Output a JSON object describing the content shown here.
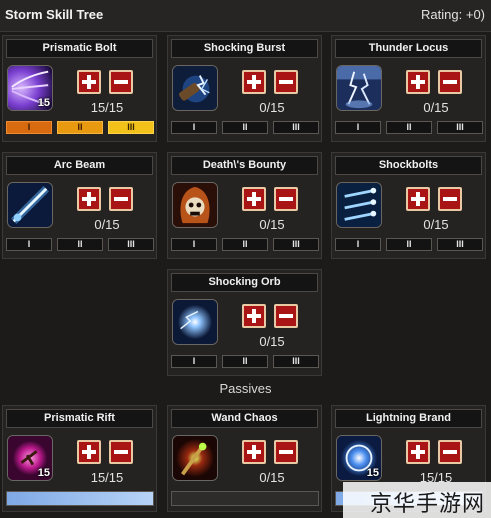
{
  "header": {
    "title": "Storm Skill Tree",
    "rating": "Rating: +0)"
  },
  "tier_labels": [
    "I",
    "II",
    "III"
  ],
  "skills": [
    {
      "name": "Prismatic Bolt",
      "icon": "prismatic-bolt-icon",
      "count": "15/15",
      "badge": "15",
      "tiers_active": [
        true,
        true,
        true
      ]
    },
    {
      "name": "Shocking Burst",
      "icon": "shocking-burst-icon",
      "count": "0/15",
      "badge": "",
      "tiers_active": [
        false,
        false,
        false
      ]
    },
    {
      "name": "Thunder Locus",
      "icon": "thunder-locus-icon",
      "count": "0/15",
      "badge": "",
      "tiers_active": [
        false,
        false,
        false
      ]
    },
    {
      "name": "Arc Beam",
      "icon": "arc-beam-icon",
      "count": "0/15",
      "badge": "",
      "tiers_active": [
        false,
        false,
        false
      ]
    },
    {
      "name": "Death\\'s Bounty",
      "icon": "deaths-bounty-icon",
      "count": "0/15",
      "badge": "",
      "tiers_active": [
        false,
        false,
        false
      ]
    },
    {
      "name": "Shockbolts",
      "icon": "shockbolts-icon",
      "count": "0/15",
      "badge": "",
      "tiers_active": [
        false,
        false,
        false
      ]
    },
    {
      "name": "Shocking Orb",
      "icon": "shocking-orb-icon",
      "count": "0/15",
      "badge": "",
      "tiers_active": [
        false,
        false,
        false
      ]
    }
  ],
  "section": {
    "passives_label": "Passives"
  },
  "passives": [
    {
      "name": "Prismatic Rift",
      "icon": "prismatic-rift-icon",
      "count": "15/15",
      "badge": "15",
      "progress": 1.0
    },
    {
      "name": "Wand Chaos",
      "icon": "wand-chaos-icon",
      "count": "0/15",
      "badge": "",
      "progress": 0.0
    },
    {
      "name": "Lightning Brand",
      "icon": "lightning-brand-icon",
      "count": "15/15",
      "badge": "15",
      "progress": 1.0
    }
  ],
  "watermark": "京华手游网",
  "colors": {
    "button_red": "#a91515",
    "tier_orange": "#d86a10",
    "tier_yellow": "#f2c21a",
    "progress_blue": "#9cc0f0"
  }
}
